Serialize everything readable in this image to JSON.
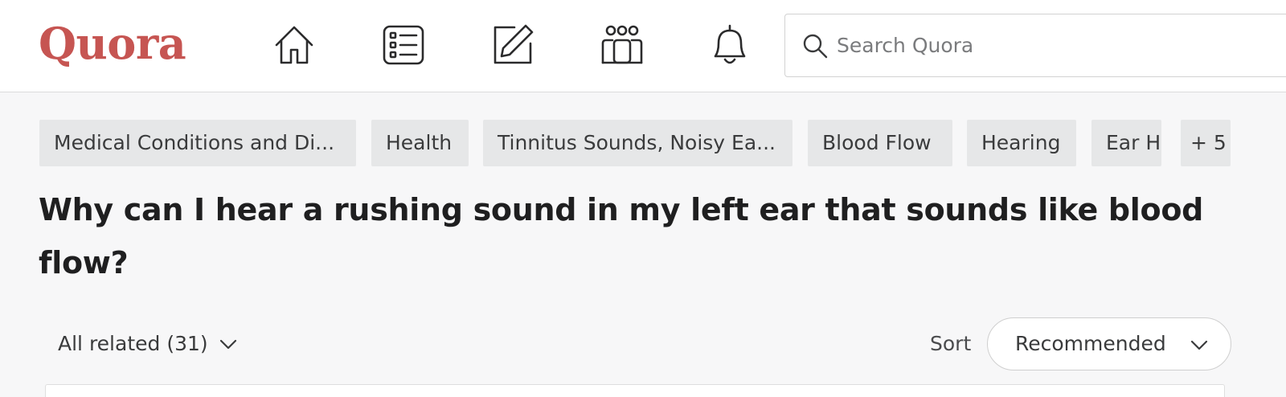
{
  "header": {
    "logo": "Quora",
    "nav": [
      {
        "icon": "home-icon"
      },
      {
        "icon": "following-list-icon"
      },
      {
        "icon": "answer-edit-icon"
      },
      {
        "icon": "spaces-icon"
      },
      {
        "icon": "notifications-bell-icon"
      }
    ],
    "search": {
      "placeholder": "Search Quora",
      "value": ""
    },
    "colors": {
      "brand": "#b92b27"
    }
  },
  "topics": [
    {
      "label": "Medical Conditions and Di..."
    },
    {
      "label": "Health"
    },
    {
      "label": "Tinnitus Sounds, Noisy Ea..."
    },
    {
      "label": "Blood Flow"
    },
    {
      "label": "Hearing"
    },
    {
      "label": "Ear H"
    },
    {
      "label": "+ 5"
    }
  ],
  "question": {
    "title": "Why can I hear a rushing sound in my left ear that sounds like blood flow?"
  },
  "answers_bar": {
    "filter_label": "All related (31)",
    "sort_label": "Sort",
    "sort_value": "Recommended"
  }
}
